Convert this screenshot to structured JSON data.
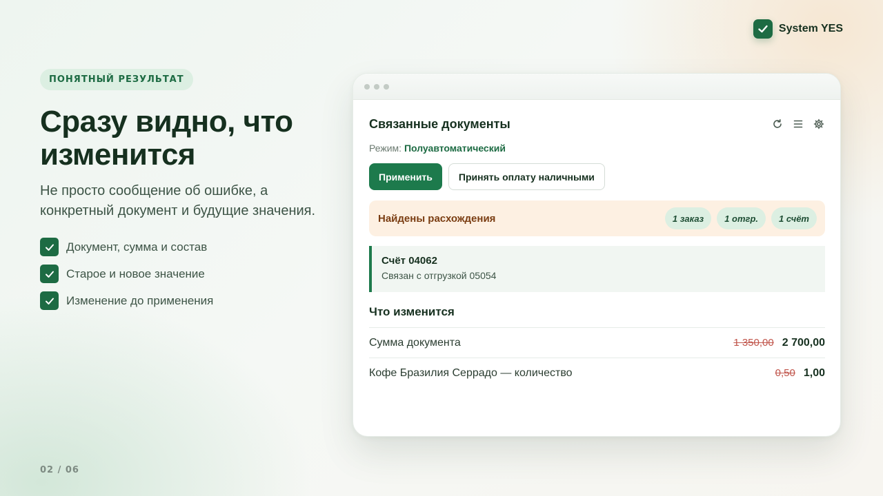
{
  "brand": {
    "name": "System YES",
    "icon": "check-icon"
  },
  "left": {
    "pill": "ПОНЯТНЫЙ РЕЗУЛЬТАТ",
    "headline": "Сразу видно, что изменится",
    "subtitle": "Не просто сообщение об ошибке, а конкретный документ и будущие значения.",
    "features": [
      "Документ, сумма и состав",
      "Старое и новое значение",
      "Изменение до применения"
    ]
  },
  "page_number": "02 / 06",
  "window": {
    "title": "Связанные документы",
    "toolbar_icons": [
      "refresh-icon",
      "menu-icon",
      "settings-icon"
    ],
    "mode_label": "Режим:",
    "mode_value": "Полуавтоматический",
    "buttons": {
      "apply": "Применить",
      "cash": "Принять оплату наличными"
    },
    "alert": {
      "title": "Найдены расхождения",
      "chips": [
        "1 заказ",
        "1 отгр.",
        "1 счёт"
      ]
    },
    "document": {
      "title": "Счёт 04062",
      "subtitle": "Связан с отгрузкой 05054"
    },
    "changes_title": "Что изменится",
    "changes": [
      {
        "label": "Сумма документа",
        "old": "1 350,00",
        "new": "2 700,00"
      },
      {
        "label": "Кофе Бразилия Серрадо — количество",
        "old": "0,50",
        "new": "1,00"
      }
    ]
  },
  "colors": {
    "accent": "#1d7a4c",
    "brand_dark": "#1d6b43",
    "text": "#16301f",
    "warning_bg": "#fdf0e2",
    "warning_text": "#7a3d12",
    "old_value": "#c0544a"
  }
}
